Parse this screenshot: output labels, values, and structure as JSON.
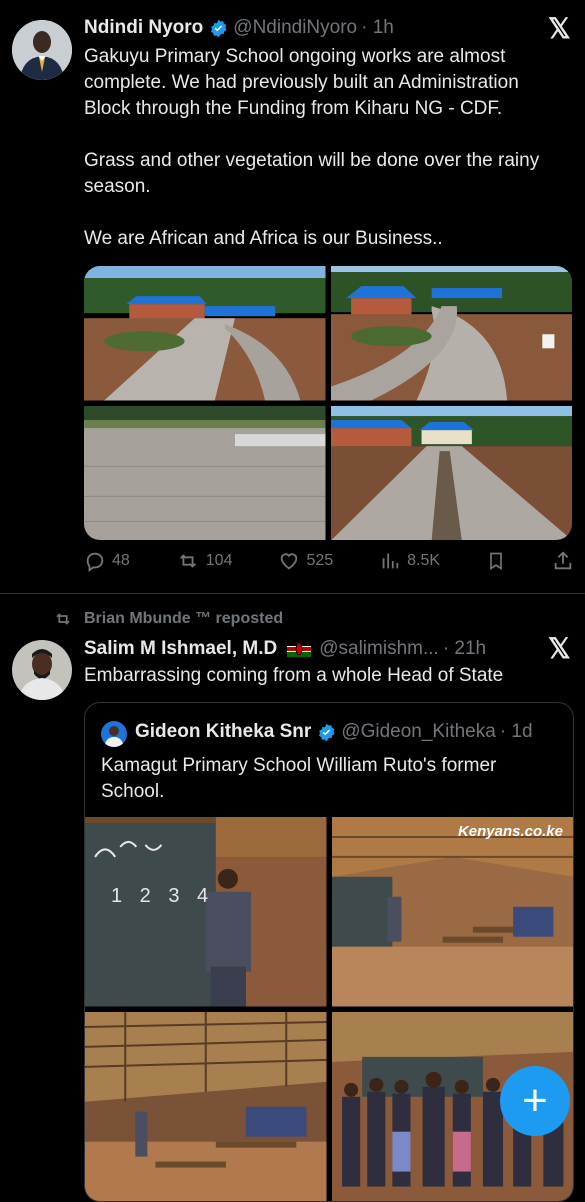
{
  "tweet1": {
    "display_name": "Ndindi Nyoro",
    "handle": "@NdindiNyoro",
    "time": "· 1h",
    "text_lines": [
      "Gakuyu Primary School ongoing works are almost",
      "complete. We had previously built an Administration",
      "Block through the Funding from Kiharu NG - CDF.",
      "",
      "Grass and other vegetation will be done over the rainy",
      "season.",
      "",
      "We are African and Africa is our Business.."
    ],
    "x_logo": "𝕏",
    "stats": {
      "replies": "48",
      "reposts": "104",
      "likes": "525",
      "views": "8.5K"
    }
  },
  "tweet2": {
    "repost_by": "Brian Mbunde ™ reposted",
    "display_name": "Salim M Ishmael, M.D",
    "handle": "@salimishm...",
    "time": "· 21h",
    "text": "Embarrassing coming from a whole Head of State",
    "x_logo": "𝕏",
    "quote": {
      "display_name": "Gideon Kitheka Snr",
      "handle": "@Gideon_Kitheka",
      "time": "· 1d",
      "text_lines": [
        "Kamagut Primary School William Ruto's former",
        "School."
      ],
      "watermark": "Kenyans.co.ke",
      "chalk_text": "1 2 3 4"
    }
  },
  "fab_icon": "+",
  "colors": {
    "accent": "#1d9bf0",
    "muted": "#71767b",
    "divider": "#2f3336",
    "text": "#e7e9ea"
  }
}
